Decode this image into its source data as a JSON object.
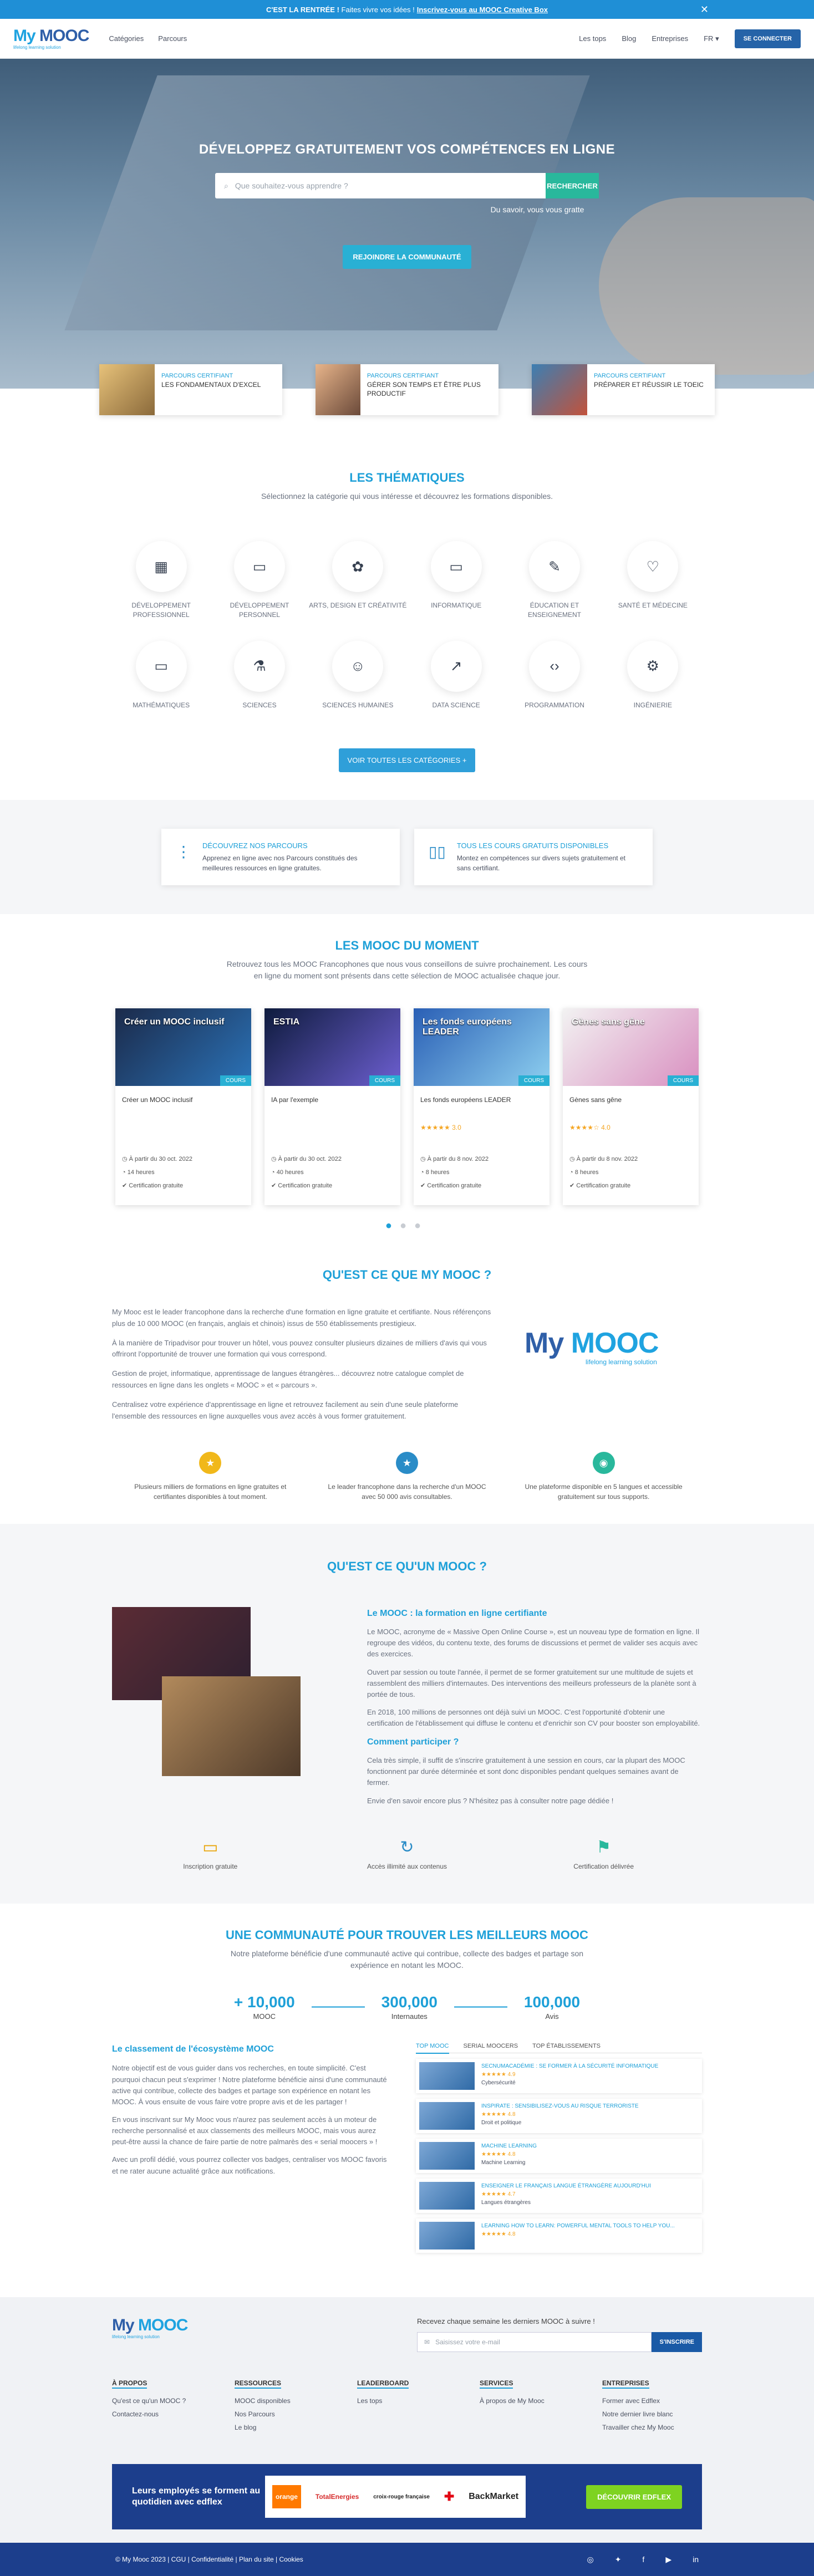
{
  "banner": {
    "bold": "C'EST LA RENTRÉE !",
    "text": "Faites vivre vos idées !",
    "link": "Inscrivez-vous au MOOC Creative Box"
  },
  "nav": {
    "logo_a": "My",
    "logo_b": "MOOC",
    "tagline": "lifelong learning solution",
    "links": [
      "Catégories",
      "Parcours"
    ],
    "right": [
      "Les tops",
      "Blog",
      "Entreprises",
      "FR"
    ],
    "login": "SE CONNECTER"
  },
  "hero": {
    "title": "DÉVELOPPEZ GRATUITEMENT VOS COMPÉTENCES EN LIGNE",
    "placeholder": "Que souhaitez-vous apprendre ?",
    "search_btn": "RECHERCHER",
    "note": "Du savoir, vous vous gratte",
    "cta": "REJOINDRE LA COMMUNAUTÉ"
  },
  "parcours": [
    {
      "tag": "PARCOURS CERTIFIANT",
      "title": "LES FONDAMENTAUX D'EXCEL"
    },
    {
      "tag": "PARCOURS CERTIFIANT",
      "title": "GÉRER SON TEMPS ET ÊTRE PLUS PRODUCTIF"
    },
    {
      "tag": "PARCOURS CERTIFIANT",
      "title": "PRÉPARER ET RÉUSSIR LE TOEIC"
    }
  ],
  "themes": {
    "title": "LES THÉMATIQUES",
    "sub": "Sélectionnez la catégorie qui vous intéresse et découvrez les formations disponibles.",
    "items": [
      {
        "label": "DÉVELOPPEMENT PROFESSIONNEL",
        "icon": "▦"
      },
      {
        "label": "DÉVELOPPEMENT PERSONNEL",
        "icon": "▭"
      },
      {
        "label": "ARTS, DESIGN ET CRÉATIVITÉ",
        "icon": "✿"
      },
      {
        "label": "INFORMATIQUE",
        "icon": "▭"
      },
      {
        "label": "ÉDUCATION ET ENSEIGNEMENT",
        "icon": "✎"
      },
      {
        "label": "SANTÉ ET MÉDECINE",
        "icon": "♡"
      },
      {
        "label": "MATHÉMATIQUES",
        "icon": "▭"
      },
      {
        "label": "SCIENCES",
        "icon": "⚗"
      },
      {
        "label": "SCIENCES HUMAINES",
        "icon": "☺"
      },
      {
        "label": "DATA SCIENCE",
        "icon": "↗"
      },
      {
        "label": "PROGRAMMATION",
        "icon": "‹›"
      },
      {
        "label": "INGÉNIERIE",
        "icon": "⚙"
      }
    ],
    "btn": "VOIR TOUTES LES CATÉGORIES +"
  },
  "discover": [
    {
      "title": "DÉCOUVREZ NOS PARCOURS",
      "text": "Apprenez en ligne avec nos Parcours constitués des meilleures ressources en ligne gratuites."
    },
    {
      "title": "TOUS LES COURS GRATUITS DISPONIBLES",
      "text": "Montez en compétences sur divers sujets gratuitement et sans certifiant."
    }
  ],
  "mooc": {
    "title": "LES MOOC DU MOMENT",
    "sub1": "Retrouvez tous les MOOC Francophones que nous vous conseillons de suivre prochainement. Les cours",
    "sub2": "en ligne du moment sont présents dans cette sélection de MOOC actualisée chaque jour.",
    "cards": [
      {
        "cover_text": "Créer un MOOC inclusif",
        "tag": "COURS",
        "title": "Créer un MOOC inclusif",
        "stars": "",
        "date": "À partir du 30 oct. 2022",
        "hours": "14 heures",
        "cert": "Certification gratuite",
        "c1": "#1b2a4a",
        "c2": "#2b73b8"
      },
      {
        "cover_text": "ESTIA",
        "tag": "COURS",
        "title": "IA par l'exemple",
        "stars": "",
        "date": "À partir du 30 oct. 2022",
        "hours": "40 heures",
        "cert": "Certification gratuite",
        "c1": "#0e1b3d",
        "c2": "#6d5fd1"
      },
      {
        "cover_text": "Les fonds européens LEADER",
        "tag": "COURS",
        "title": "Les fonds européens LEADER",
        "stars": "★★★★★ 3.0",
        "date": "À partir du 8 nov. 2022",
        "hours": "8 heures",
        "cert": "Certification gratuite",
        "c1": "#2a5fb5",
        "c2": "#8ed0f0"
      },
      {
        "cover_text": "Gènes sans gêne",
        "tag": "COURS",
        "title": "Gènes sans gêne",
        "stars": "★★★★☆ 4.0",
        "date": "À partir du 8 nov. 2022",
        "hours": "8 heures",
        "cert": "Certification gratuite",
        "c1": "#f2f2f2",
        "c2": "#d98fc0"
      }
    ]
  },
  "what": {
    "title": "QU'EST CE QUE MY MOOC ?",
    "paras": [
      "My Mooc est le leader francophone dans la recherche d'une formation en ligne gratuite et certifiante. Nous référençons plus de 10 000 MOOC (en français, anglais et chinois) issus de 550 établissements prestigieux.",
      "À la manière de Tripadvisor pour trouver un hôtel, vous pouvez consulter plusieurs dizaines de milliers d'avis qui vous offriront l'opportunité de trouver une formation qui vous correspond.",
      "Gestion de projet, informatique, apprentissage de langues étrangères... découvrez notre catalogue complet de ressources en ligne dans les onglets « MOOC » et « parcours ».",
      "Centralisez votre expérience d'apprentissage en ligne et retrouvez facilement au sein d'une seule plateforme l'ensemble des ressources en ligne auxquelles vous avez accès à vous former gratuitement."
    ],
    "logo_tag": "lifelong learning solution",
    "three": [
      "Plusieurs milliers de formations en ligne gratuites et certifiantes disponibles à tout moment.",
      "Le leader francophone dans la recherche d'un MOOC avec 50 000 avis consultables.",
      "Une plateforme disponible en 5 langues et accessible gratuitement sur tous supports."
    ]
  },
  "whatmooc": {
    "title": "QU'EST CE QU'UN MOOC ?",
    "h1": "Le MOOC : la formation en ligne certifiante",
    "p": [
      "Le MOOC, acronyme de « Massive Open Online Course », est un nouveau type de formation en ligne. Il regroupe des vidéos, du contenu texte, des forums de discussions et permet de valider ses acquis avec des exercices.",
      "Ouvert par session ou toute l'année, il permet de se former gratuitement sur une multitude de sujets et rassemblent des milliers d'internautes. Des interventions des meilleurs professeurs de la planète sont à portée de tous.",
      "En 2018, 100 millions de personnes ont déjà suivi un MOOC. C'est l'opportunité d'obtenir une certification de l'établissement qui diffuse le contenu et d'enrichir son CV pour booster son employabilité."
    ],
    "h2": "Comment participer ?",
    "p2": "Cela très simple, il suffit de s'inscrire gratuitement à une session en cours, car la plupart des MOOC fonctionnent par durée déterminée et sont donc disponibles pendant quelques semaines avant de fermer.",
    "p3": "Envie d'en savoir encore plus ? N'hésitez pas à consulter notre page dédiée !",
    "feats": [
      "Inscription gratuite",
      "Accès illimité aux contenus",
      "Certification délivrée"
    ]
  },
  "community": {
    "title": "UNE COMMUNAUTÉ POUR TROUVER LES MEILLEURS MOOC",
    "sub1": "Notre plateforme bénéficie d'une communauté active qui contribue, collecte des badges et partage son",
    "sub2": "expérience en notant les MOOC.",
    "stats": [
      {
        "n": "+ 10,000",
        "l": "MOOC"
      },
      {
        "n": "300,000",
        "l": "Internautes"
      },
      {
        "n": "100,000",
        "l": "Avis"
      }
    ],
    "h": "Le classement de l'écosystème MOOC",
    "p": [
      "Notre objectif est de vous guider dans vos recherches, en toute simplicité. C'est pourquoi chacun peut s'exprimer ! Notre plateforme bénéficie ainsi d'une communauté active qui contribue, collecte des badges et partage son expérience en notant les MOOC. À vous ensuite de vous faire votre propre avis et de les partager !",
      "En vous inscrivant sur My Mooc vous n'aurez pas seulement accès à un moteur de recherche personnalisé et aux classements des meilleurs MOOC, mais vous aurez peut-être aussi la chance de faire partie de notre palmarès des « serial moocers » !",
      "Avec un profil dédié, vous pourrez collecter vos badges, centraliser vos MOOC favoris et ne rater aucune actualité grâce aux notifications."
    ],
    "tabs": [
      "TOP MOOC",
      "SERIAL MOOCERS",
      "TOP ÉTABLISSEMENTS"
    ],
    "tops": [
      {
        "t": "SECNUMACADÉMIE : SE FORMER À LA SÉCURITÉ INFORMATIQUE",
        "s": "★★★★★ 4.9",
        "o": "Cybersécurité"
      },
      {
        "t": "INSPIRATE : SENSIBILISEZ-VOUS AU RISQUE TERRORISTE",
        "s": "★★★★★ 4.8",
        "o": "Droit et politique"
      },
      {
        "t": "MACHINE LEARNING",
        "s": "★★★★★ 4.8",
        "o": "Machine Learning"
      },
      {
        "t": "ENSEIGNER LE FRANÇAIS LANGUE ÉTRANGÈRE AUJOURD'HUI",
        "s": "★★★★★ 4.7",
        "o": "Langues étrangères"
      },
      {
        "t": "LEARNING HOW TO LEARN: POWERFUL MENTAL TOOLS TO HELP YOU...",
        "s": "★★★★★ 4.8",
        "o": ""
      }
    ]
  },
  "footer": {
    "news_label": "Recevez chaque semaine les derniers MOOC à suivre !",
    "placeholder": "Saisissez votre e-mail",
    "news_btn": "S'INSCRIRE",
    "cols": [
      {
        "h": "À PROPOS",
        "items": [
          "Qu'est ce qu'un MOOC ?",
          "Contactez-nous"
        ]
      },
      {
        "h": "RESSOURCES",
        "items": [
          "MOOC disponibles",
          "Nos Parcours",
          "Le blog"
        ]
      },
      {
        "h": "LEADERBOARD",
        "items": [
          "Les tops"
        ]
      },
      {
        "h": "SERVICES",
        "items": [
          "À propos de My Mooc"
        ]
      },
      {
        "h": "ENTREPRISES",
        "items": [
          "Former avec Edflex",
          "Notre dernier livre blanc",
          "Travailler chez My Mooc"
        ]
      }
    ],
    "edflex_text": "Leurs employés se forment au quotidien avec edflex",
    "edflex_logos": [
      "orange",
      "TotalEnergies",
      "croix-rouge française",
      "✚",
      "BackMarket"
    ],
    "edflex_cta": "DÉCOUVRIR EDFLEX",
    "bottom": "© My Mooc 2023 | CGU | Confidentialité | Plan du site | Cookies"
  }
}
